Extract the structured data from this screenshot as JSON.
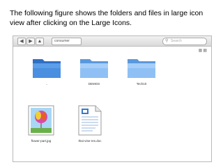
{
  "caption": "The following figure shows the folders and files in large icon view after clicking on the Large Icons.",
  "toolbar": {
    "back_icon": "back-arrow-icon",
    "forward_icon": "forward-arrow-icon",
    "up_icon": "up-arrow-icon",
    "breadcrumb": "consumer",
    "search_placeholder": "Search"
  },
  "items": [
    {
      "name": "..",
      "kind": "folder"
    },
    {
      "name": "DEMOS",
      "kind": "folder"
    },
    {
      "name": "Tech10",
      "kind": "folder"
    },
    {
      "name": "flower-part.jpg",
      "kind": "image"
    },
    {
      "name": "thai-vise-res.doc",
      "kind": "document"
    }
  ],
  "colors": {
    "folder": "#4a8fe0",
    "folder_light": "#8fc0f5",
    "toolbar": "#e3e3e3"
  }
}
